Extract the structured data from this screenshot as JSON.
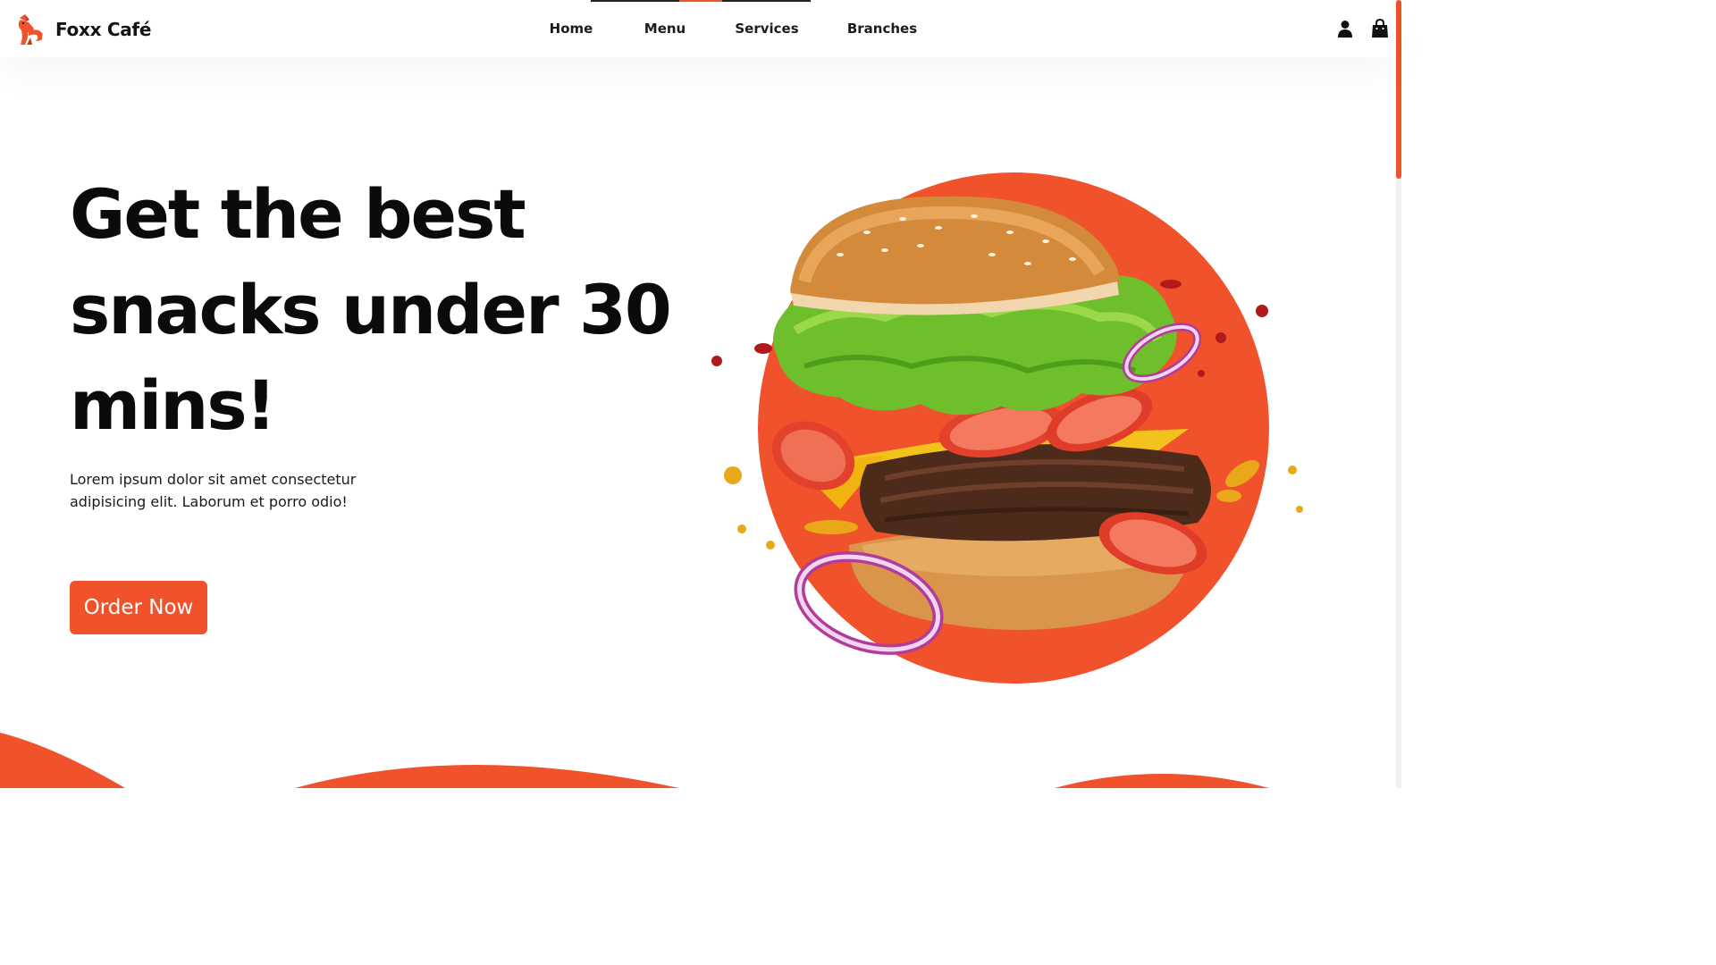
{
  "header": {
    "brand": "Foxx Café",
    "nav": [
      {
        "label": "Home"
      },
      {
        "label": "Menu"
      },
      {
        "label": "Services"
      },
      {
        "label": "Branches"
      }
    ],
    "icons": [
      "user-icon",
      "shopping-bag-icon"
    ]
  },
  "hero": {
    "headline": "Get the best snacks under 30 mins!",
    "description": "Lorem ipsum dolor sit amet consectetur adipisicing elit. Laborum et porro odio!",
    "cta_label": "Order Now",
    "image": "burger-image"
  },
  "colors": {
    "accent": "#f0522b",
    "text": "#0b0b0b",
    "background": "#ffffff"
  }
}
